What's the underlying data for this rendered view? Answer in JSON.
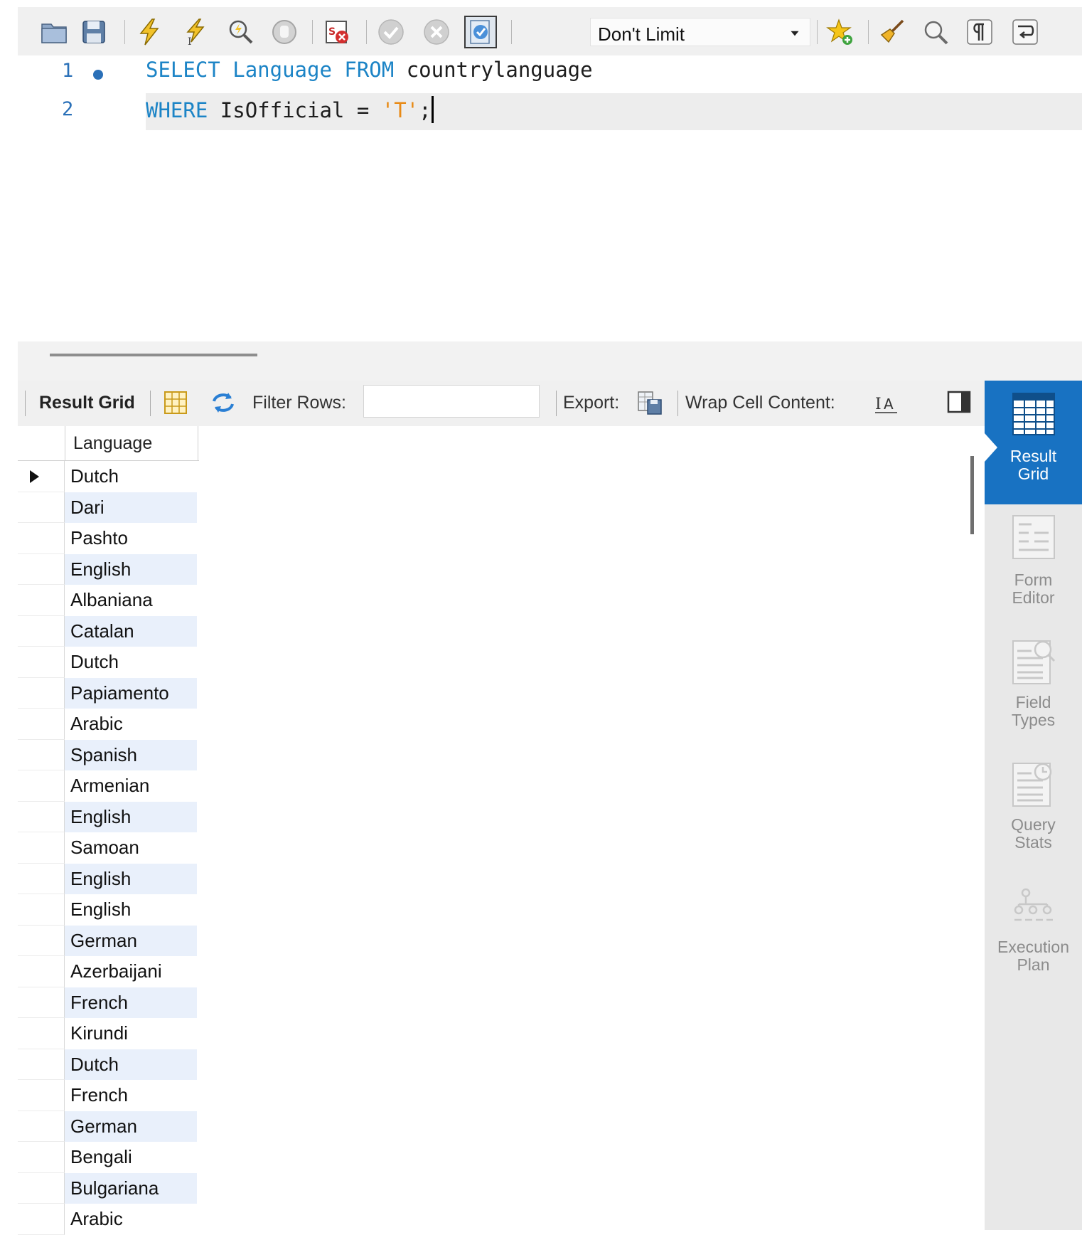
{
  "toolbar": {
    "limit_value": "Don't Limit"
  },
  "editor": {
    "lines": [
      {
        "number": "1",
        "tokens": [
          {
            "t": "kw",
            "v": "SELECT"
          },
          {
            "t": "txt",
            "v": " "
          },
          {
            "t": "kw",
            "v": "Language"
          },
          {
            "t": "txt",
            "v": " "
          },
          {
            "t": "kw",
            "v": "FROM"
          },
          {
            "t": "txt",
            "v": " countrylanguage"
          }
        ]
      },
      {
        "number": "2",
        "tokens": [
          {
            "t": "kw",
            "v": "WHERE"
          },
          {
            "t": "txt",
            "v": " IsOfficial = "
          },
          {
            "t": "str",
            "v": "'T'"
          },
          {
            "t": "txt",
            "v": ";"
          }
        ]
      }
    ]
  },
  "result_toolbar": {
    "result_grid_label": "Result Grid",
    "filter_label": "Filter Rows:",
    "filter_value": "",
    "export_label": "Export:",
    "wrap_label": "Wrap Cell Content:"
  },
  "grid": {
    "columns": [
      "Language"
    ],
    "rows": [
      "Dutch",
      "Dari",
      "Pashto",
      "English",
      "Albaniana",
      "Catalan",
      "Dutch",
      "Papiamento",
      "Arabic",
      "Spanish",
      "Armenian",
      "English",
      "Samoan",
      "English",
      "English",
      "German",
      "Azerbaijani",
      "French",
      "Kirundi",
      "Dutch",
      "French",
      "German",
      "Bengali",
      "Bulgariana",
      "Arabic"
    ]
  },
  "side_panel": [
    {
      "label1": "Result",
      "label2": "Grid",
      "icon": "result-grid-icon",
      "active": true
    },
    {
      "label1": "Form",
      "label2": "Editor",
      "icon": "form-editor-icon",
      "active": false
    },
    {
      "label1": "Field",
      "label2": "Types",
      "icon": "field-types-icon",
      "active": false
    },
    {
      "label1": "Query",
      "label2": "Stats",
      "icon": "query-stats-icon",
      "active": false
    },
    {
      "label1": "Execution",
      "label2": "Plan",
      "icon": "execution-plan-icon",
      "active": false
    }
  ],
  "colors": {
    "keyword": "#1c84c6",
    "string": "#e88a16",
    "accent": "#1872c2",
    "row_alt": "#e9f0fb"
  }
}
